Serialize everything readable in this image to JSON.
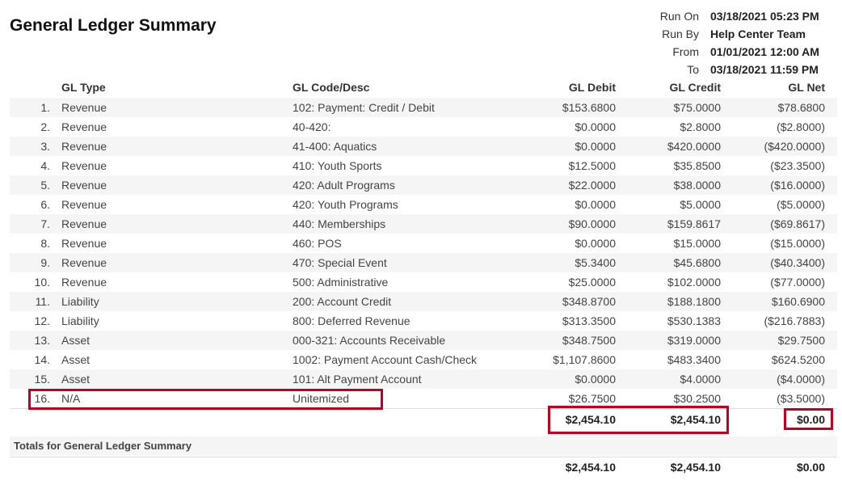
{
  "report": {
    "title": "General Ledger Summary",
    "meta": [
      {
        "label": "Run On",
        "value": "03/18/2021 05:23 PM"
      },
      {
        "label": "Run By",
        "value": "Help Center Team"
      },
      {
        "label": "From",
        "value": "01/01/2021 12:00 AM"
      },
      {
        "label": "To",
        "value": "03/18/2021 11:59 PM"
      }
    ]
  },
  "table": {
    "headers": {
      "type": "GL Type",
      "code": "GL Code/Desc",
      "debit": "GL Debit",
      "credit": "GL Credit",
      "net": "GL Net"
    },
    "rows": [
      {
        "num": "1.",
        "type": "Revenue",
        "code": "102: Payment: Credit / Debit",
        "debit": "$153.6800",
        "credit": "$75.0000",
        "net": "$78.6800"
      },
      {
        "num": "2.",
        "type": "Revenue",
        "code": "40-420:",
        "debit": "$0.0000",
        "credit": "$2.8000",
        "net": "($2.8000)"
      },
      {
        "num": "3.",
        "type": "Revenue",
        "code": "41-400: Aquatics",
        "debit": "$0.0000",
        "credit": "$420.0000",
        "net": "($420.0000)"
      },
      {
        "num": "4.",
        "type": "Revenue",
        "code": "410: Youth Sports",
        "debit": "$12.5000",
        "credit": "$35.8500",
        "net": "($23.3500)"
      },
      {
        "num": "5.",
        "type": "Revenue",
        "code": "420: Adult Programs",
        "debit": "$22.0000",
        "credit": "$38.0000",
        "net": "($16.0000)"
      },
      {
        "num": "6.",
        "type": "Revenue",
        "code": "420: Youth Programs",
        "debit": "$0.0000",
        "credit": "$5.0000",
        "net": "($5.0000)"
      },
      {
        "num": "7.",
        "type": "Revenue",
        "code": "440: Memberships",
        "debit": "$90.0000",
        "credit": "$159.8617",
        "net": "($69.8617)"
      },
      {
        "num": "8.",
        "type": "Revenue",
        "code": "460: POS",
        "debit": "$0.0000",
        "credit": "$15.0000",
        "net": "($15.0000)"
      },
      {
        "num": "9.",
        "type": "Revenue",
        "code": "470: Special Event",
        "debit": "$5.3400",
        "credit": "$45.6800",
        "net": "($40.3400)"
      },
      {
        "num": "10.",
        "type": "Revenue",
        "code": "500: Administrative",
        "debit": "$25.0000",
        "credit": "$102.0000",
        "net": "($77.0000)"
      },
      {
        "num": "11.",
        "type": "Liability",
        "code": "200: Account Credit",
        "debit": "$348.8700",
        "credit": "$188.1800",
        "net": "$160.6900"
      },
      {
        "num": "12.",
        "type": "Liability",
        "code": "800: Deferred Revenue",
        "debit": "$313.3500",
        "credit": "$530.1383",
        "net": "($216.7883)"
      },
      {
        "num": "13.",
        "type": "Asset",
        "code": "000-321: Accounts Receivable",
        "debit": "$348.7500",
        "credit": "$319.0000",
        "net": "$29.7500"
      },
      {
        "num": "14.",
        "type": "Asset",
        "code": "1002: Payment Account Cash/Check",
        "debit": "$1,107.8600",
        "credit": "$483.3400",
        "net": "$624.5200"
      },
      {
        "num": "15.",
        "type": "Asset",
        "code": "101: Alt Payment Account",
        "debit": "$0.0000",
        "credit": "$4.0000",
        "net": "($4.0000)"
      },
      {
        "num": "16.",
        "type": "N/A",
        "code": "Unitemized",
        "debit": "$26.7500",
        "credit": "$30.2500",
        "net": "($3.5000)"
      }
    ],
    "subtotal": {
      "debit": "$2,454.10",
      "credit": "$2,454.10",
      "net": "$0.00"
    }
  },
  "totals": {
    "label": "Totals for General Ledger Summary",
    "debit": "$2,454.10",
    "credit": "$2,454.10",
    "net": "$0.00"
  },
  "highlight_color": "#c00020"
}
